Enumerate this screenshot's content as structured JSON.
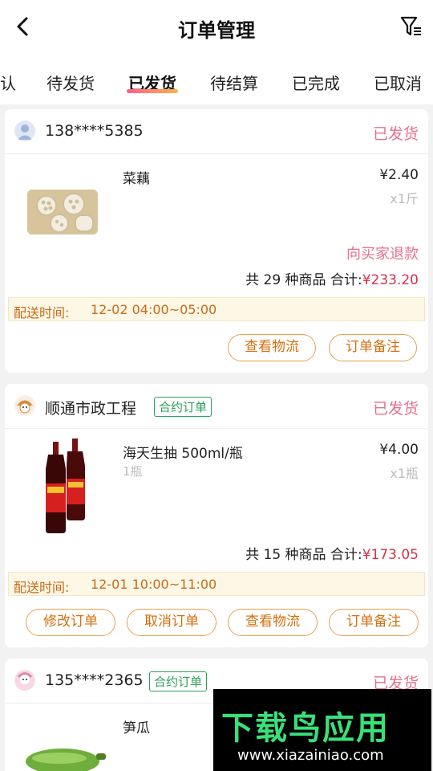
{
  "header": {
    "title": "订单管理"
  },
  "tabs": [
    "认",
    "待发货",
    "已发货",
    "待结算",
    "已完成",
    "已取消"
  ],
  "orders": [
    {
      "customer": "138****5385",
      "contract_tag": "",
      "status": "已发货",
      "product": {
        "name": "菜藕",
        "spec": "",
        "price": "¥2.40",
        "qty": "x1斤"
      },
      "refund_label": "向买家退款",
      "summary": {
        "prefix": "共 29 种商品 合计:",
        "amount": "¥233.20"
      },
      "delivery": {
        "label": "配送时间:",
        "time": "12-02 04:00~05:00"
      },
      "buttons": [
        "查看物流",
        "订单备注"
      ]
    },
    {
      "customer": "顺通市政工程",
      "contract_tag": "合约订单",
      "status": "已发货",
      "product": {
        "name": "海天生抽 500ml/瓶",
        "spec": "1瓶",
        "price": "¥4.00",
        "qty": "x1瓶"
      },
      "refund_label": "",
      "summary": {
        "prefix": "共 15 种商品 合计:",
        "amount": "¥173.05"
      },
      "delivery": {
        "label": "配送时间:",
        "time": "12-01 10:00~11:00"
      },
      "buttons": [
        "修改订单",
        "取消订单",
        "查看物流",
        "订单备注"
      ]
    },
    {
      "customer": "135****2365",
      "contract_tag": "合约订单",
      "status": "已发货",
      "product": {
        "name": "笋瓜"
      }
    }
  ],
  "watermark": {
    "brand": "下载鸟应用",
    "url": "www.xiazainiao.com"
  },
  "colors": {
    "status": "#e8708a",
    "amount": "#d8304a",
    "button": "#e8a24f",
    "contract": "#2aa05a",
    "delivery_bg": "#fdf7e6"
  }
}
